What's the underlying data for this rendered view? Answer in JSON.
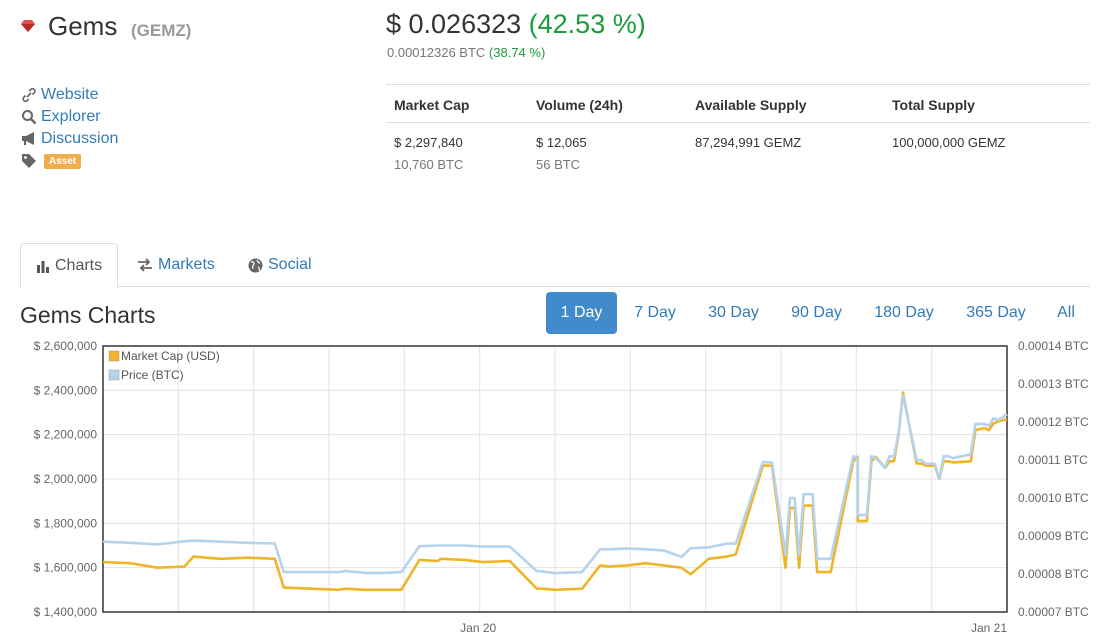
{
  "coin": {
    "name": "Gems",
    "symbol": "(GEMZ)",
    "price_usd": "$ 0.026323",
    "change_usd": "(42.53 %)",
    "price_btc": "0.00012326 BTC",
    "change_btc": "(38.74 %)"
  },
  "links": {
    "website": "Website",
    "explorer": "Explorer",
    "discussion": "Discussion",
    "tag": "Asset"
  },
  "stats": {
    "headers": [
      "Market Cap",
      "Volume (24h)",
      "Available Supply",
      "Total Supply"
    ],
    "market_cap_usd": "$ 2,297,840",
    "market_cap_btc": "10,760 BTC",
    "volume_usd": "$ 12,065",
    "volume_btc": "56 BTC",
    "available_supply": "87,294,991 GEMZ",
    "total_supply": "100,000,000 GEMZ"
  },
  "tabs": [
    "Charts",
    "Markets",
    "Social"
  ],
  "charts_title": "Gems Charts",
  "ranges": [
    "1 Day",
    "7 Day",
    "30 Day",
    "90 Day",
    "180 Day",
    "365 Day",
    "All"
  ],
  "active_range": "1 Day",
  "colors": {
    "market_cap": "#f0b429",
    "price": "#b5d3ec",
    "positive": "#1a9c3d",
    "link": "#337ab7",
    "active_button": "#428bca",
    "gem": "#d9534f"
  },
  "chart_data": {
    "type": "line",
    "x_labels": [
      "Jan 20",
      "Jan 21"
    ],
    "ylim_left": [
      1400000,
      2600000
    ],
    "ylim_right": [
      7e-05,
      0.00014
    ],
    "left_ticks": [
      "$ 1,400,000",
      "$ 1,600,000",
      "$ 1,800,000",
      "$ 2,000,000",
      "$ 2,200,000",
      "$ 2,400,000",
      "$ 2,600,000"
    ],
    "right_ticks": [
      "0.00007 BTC",
      "0.00008 BTC",
      "0.00009 BTC",
      "0.00010 BTC",
      "0.00011 BTC",
      "0.00012 BTC",
      "0.00013 BTC",
      "0.00014 BTC"
    ],
    "x": [
      0,
      0.03,
      0.06,
      0.09,
      0.1,
      0.13,
      0.16,
      0.19,
      0.2,
      0.23,
      0.26,
      0.268,
      0.29,
      0.31,
      0.33,
      0.35,
      0.37,
      0.374,
      0.4,
      0.42,
      0.45,
      0.48,
      0.485,
      0.5,
      0.53,
      0.55,
      0.56,
      0.58,
      0.6,
      0.62,
      0.64,
      0.65,
      0.67,
      0.69,
      0.7,
      0.7,
      0.73,
      0.74,
      0.74,
      0.755,
      0.76,
      0.765,
      0.77,
      0.775,
      0.785,
      0.79,
      0.79,
      0.8,
      0.805,
      0.805,
      0.83,
      0.835,
      0.835,
      0.845,
      0.85,
      0.855,
      0.865,
      0.87,
      0.875,
      0.88,
      0.88,
      0.885,
      0.9,
      0.9,
      0.905,
      0.91,
      0.92,
      0.925,
      0.93,
      0.935,
      0.94,
      0.96,
      0.965,
      0.975,
      0.98,
      0.985,
      0.99,
      1.0
    ],
    "series": [
      {
        "name": "Market Cap (USD)",
        "axis": "left",
        "values": [
          1625000,
          1620000,
          1600000,
          1605000,
          1650000,
          1640000,
          1645000,
          1640000,
          1510000,
          1505000,
          1500000,
          1505000,
          1500000,
          1500000,
          1500000,
          1635000,
          1630000,
          1640000,
          1635000,
          1625000,
          1630000,
          1505000,
          1505000,
          1500000,
          1505000,
          1610000,
          1605000,
          1610000,
          1620000,
          1610000,
          1600000,
          1570000,
          1640000,
          1650000,
          1660000,
          1660000,
          2060000,
          2060000,
          2060000,
          1600000,
          1870000,
          1870000,
          1600000,
          1880000,
          1880000,
          1580000,
          1580000,
          1580000,
          1580000,
          1580000,
          2080000,
          2100000,
          1810000,
          1810000,
          2080000,
          2100000,
          2050000,
          2080000,
          2080000,
          2200000,
          2200000,
          2390000,
          2070000,
          2070000,
          2070000,
          2060000,
          2060000,
          2000000,
          2080000,
          2080000,
          2075000,
          2080000,
          2220000,
          2230000,
          2220000,
          2250000,
          2260000,
          2270000
        ]
      },
      {
        "name": "Price (BTC)",
        "axis": "right",
        "values": [
          8.85e-05,
          8.82e-05,
          8.78e-05,
          8.86e-05,
          8.88e-05,
          8.85e-05,
          8.82e-05,
          8.8e-05,
          8.05e-05,
          8.05e-05,
          8.05e-05,
          8.08e-05,
          8.03e-05,
          8.03e-05,
          8.05e-05,
          8.73e-05,
          8.75e-05,
          8.75e-05,
          8.75e-05,
          8.72e-05,
          8.72e-05,
          8.07e-05,
          8.07e-05,
          8.02e-05,
          8.05e-05,
          8.65e-05,
          8.65e-05,
          8.67e-05,
          8.65e-05,
          8.62e-05,
          8.45e-05,
          8.68e-05,
          8.7e-05,
          8.8e-05,
          8.8e-05,
          8.8e-05,
          0.0001095,
          0.0001093,
          0.0001093,
          8.5e-05,
          0.0001,
          0.0001,
          8.5e-05,
          0.000101,
          0.000101,
          8.4e-05,
          8.4e-05,
          8.4e-05,
          8.4e-05,
          8.4e-05,
          0.000111,
          0.0001105,
          9.55e-05,
          9.55e-05,
          0.000111,
          0.0001105,
          0.000108,
          0.000111,
          0.000111,
          0.000117,
          0.000117,
          0.000127,
          0.00011,
          0.00011,
          0.00011,
          0.000109,
          0.000109,
          0.000105,
          0.000111,
          0.000111,
          0.0001105,
          0.0001115,
          0.0001195,
          0.0001195,
          0.000119,
          0.000121,
          0.0001205,
          0.000122
        ]
      }
    ],
    "legend_position": "top-left",
    "grid": true
  }
}
